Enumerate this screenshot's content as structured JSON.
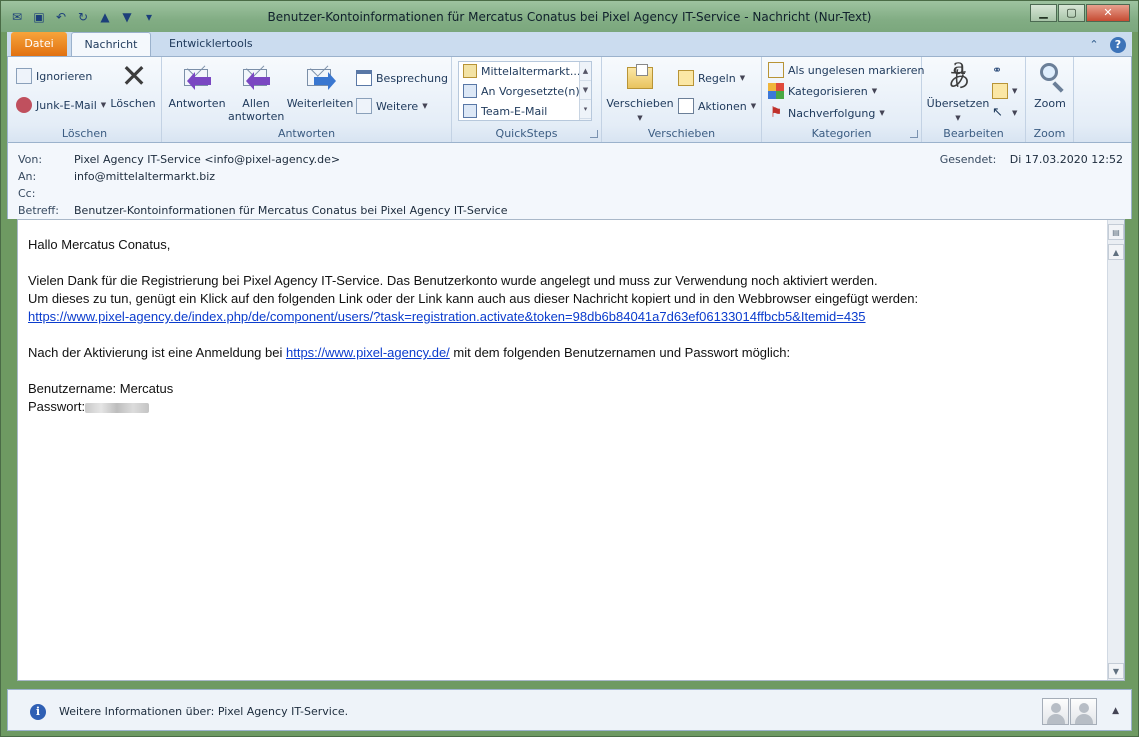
{
  "window": {
    "title": "Benutzer-Kontoinformationen für Mercatus Conatus bei Pixel Agency IT-Service  -  Nachricht (Nur-Text)"
  },
  "tabs": {
    "file": "Datei",
    "message": "Nachricht",
    "developer": "Entwicklertools"
  },
  "ribbon": {
    "loeschen": {
      "label": "Löschen",
      "ignore": "Ignorieren",
      "junk": "Junk-E-Mail",
      "delete": "Löschen"
    },
    "antworten": {
      "label": "Antworten",
      "reply": "Antworten",
      "reply_all_1": "Allen",
      "reply_all_2": "antworten",
      "forward": "Weiterleiten",
      "meeting": "Besprechung",
      "more": "Weitere"
    },
    "quicksteps": {
      "label": "QuickSteps",
      "items": [
        "Mittelaltermarkt....",
        "An Vorgesetzte(n)",
        "Team-E-Mail"
      ]
    },
    "verschieben": {
      "label": "Verschieben",
      "move": "Verschieben",
      "rules": "Regeln",
      "actions": "Aktionen"
    },
    "kategorien": {
      "label": "Kategorien",
      "unread": "Als ungelesen markieren",
      "categorize": "Kategorisieren",
      "followup": "Nachverfolgung"
    },
    "bearbeiten": {
      "label": "Bearbeiten",
      "translate": "Übersetzen"
    },
    "zoom": {
      "label": "Zoom",
      "zoom": "Zoom"
    }
  },
  "header": {
    "from_label": "Von:",
    "from_value": "Pixel Agency IT-Service <info@pixel-agency.de>",
    "to_label": "An:",
    "to_value": "info@mittelaltermarkt.biz",
    "cc_label": "Cc:",
    "cc_value": "",
    "subject_label": "Betreff:",
    "subject_value": "Benutzer-Kontoinformationen für Mercatus Conatus bei Pixel Agency IT-Service",
    "sent_label": "Gesendet:",
    "sent_value": "Di 17.03.2020 12:52"
  },
  "body": {
    "greeting": "Hallo Mercatus Conatus,",
    "line1": "Vielen Dank für die Registrierung bei Pixel Agency IT-Service. Das Benutzerkonto wurde angelegt und muss zur Verwendung noch aktiviert werden.",
    "line2": "Um dieses zu tun, genügt ein Klick auf den folgenden Link oder der Link kann auch aus dieser Nachricht kopiert und in den Webbrowser eingefügt werden:",
    "activation_link": "https://www.pixel-agency.de/index.php/de/component/users/?task=registration.activate&token=98db6b84041a7d63ef06133014ffbcb5&Itemid=435",
    "line3_pre": "Nach der Aktivierung ist eine Anmeldung bei ",
    "site_link": "https://www.pixel-agency.de/",
    "line3_post": " mit dem folgenden Benutzernamen und Passwort möglich:",
    "username_line": "Benutzername: Mercatus",
    "password_label": "Passwort:"
  },
  "people_pane": {
    "info_text": "Weitere Informationen über: Pixel Agency IT-Service."
  }
}
